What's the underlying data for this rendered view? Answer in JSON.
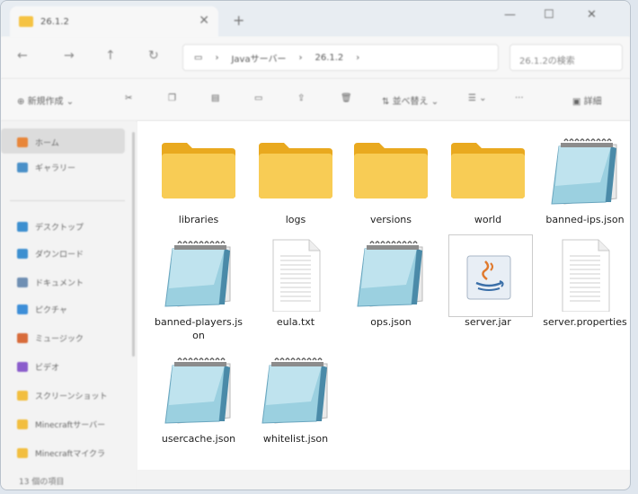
{
  "window": {
    "tab_title": "26.1.2",
    "address_segments": [
      "Javaサーバー",
      "26.1.2"
    ],
    "search_placeholder": "26.1.2の検索"
  },
  "toolbar": {
    "new_label": "新規作成",
    "sort_label": "並べ替え",
    "view_label": "表示",
    "details_label": "詳細"
  },
  "sidebar": {
    "items": [
      {
        "label": "ホーム",
        "color": "#e8863a"
      },
      {
        "label": "ギャラリー",
        "color": "#4a90c8"
      },
      {
        "label": "デスクトップ",
        "color": "#3c8fd0"
      },
      {
        "label": "ダウンロード",
        "color": "#3c8fd0"
      },
      {
        "label": "ドキュメント",
        "color": "#6f8fb3"
      },
      {
        "label": "ピクチャ",
        "color": "#3d8ed8"
      },
      {
        "label": "ミュージック",
        "color": "#d86b3a"
      },
      {
        "label": "ビデオ",
        "color": "#8a5ccc"
      },
      {
        "label": "スクリーンショット",
        "color": "#f2be3f"
      },
      {
        "label": "Minecraftサーバー",
        "color": "#f2be3f"
      },
      {
        "label": "Minecraftマイクラ",
        "color": "#f2be3f"
      }
    ]
  },
  "status": {
    "count": "13 個の項目"
  },
  "files": [
    {
      "name": "libraries",
      "type": "folder"
    },
    {
      "name": "logs",
      "type": "folder-doc"
    },
    {
      "name": "versions",
      "type": "folder"
    },
    {
      "name": "world",
      "type": "folder-img"
    },
    {
      "name": "banned-ips.json",
      "type": "notepad"
    },
    {
      "name": "banned-players.json",
      "type": "notepad"
    },
    {
      "name": "eula.txt",
      "type": "text"
    },
    {
      "name": "ops.json",
      "type": "notepad"
    },
    {
      "name": "server.jar",
      "type": "jar"
    },
    {
      "name": "server.properties",
      "type": "text"
    },
    {
      "name": "usercache.json",
      "type": "notepad"
    },
    {
      "name": "whitelist.json",
      "type": "notepad"
    }
  ]
}
